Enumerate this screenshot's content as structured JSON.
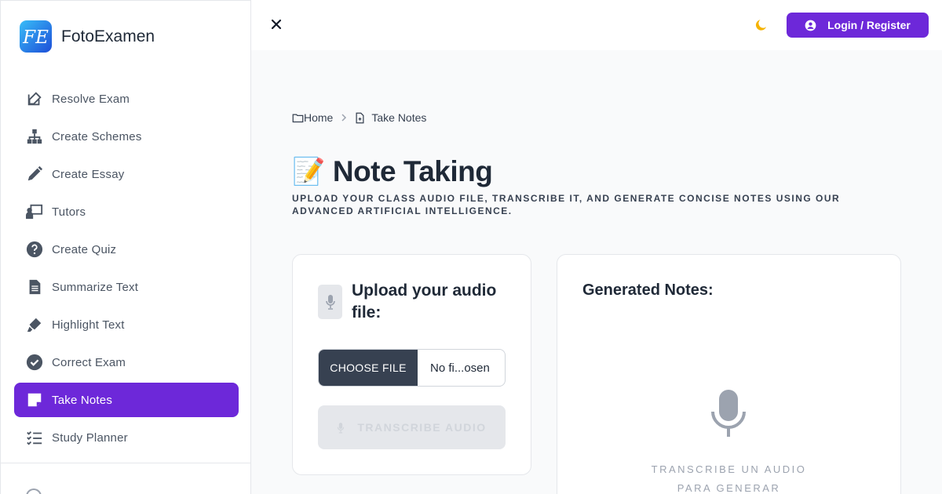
{
  "brand": {
    "name": "FotoExamen",
    "logo_text": "FE"
  },
  "sidebar": {
    "items": [
      {
        "label": "Resolve Exam",
        "icon": "edit-square-icon",
        "active": false
      },
      {
        "label": "Create Schemes",
        "icon": "hierarchy-icon",
        "active": false
      },
      {
        "label": "Create Essay",
        "icon": "pencil-icon",
        "active": false
      },
      {
        "label": "Tutors",
        "icon": "tutor-board-icon",
        "active": false
      },
      {
        "label": "Create Quiz",
        "icon": "question-circle-icon",
        "active": false
      },
      {
        "label": "Summarize Text",
        "icon": "document-icon",
        "active": false
      },
      {
        "label": "Highlight Text",
        "icon": "highlighter-icon",
        "active": false
      },
      {
        "label": "Correct Exam",
        "icon": "check-circle-icon",
        "active": false
      },
      {
        "label": "Take Notes",
        "icon": "sticky-note-icon",
        "active": true
      },
      {
        "label": "Study Planner",
        "icon": "checklist-icon",
        "active": false
      }
    ]
  },
  "topbar": {
    "login_label": "Login / Register"
  },
  "breadcrumb": {
    "home": "Home",
    "current": "Take Notes"
  },
  "page": {
    "title_emoji": "📝",
    "title": "Note Taking",
    "subtitle": "Upload your class audio file, transcribe it, and generate concise notes using our advanced artificial intelligence."
  },
  "upload": {
    "title": "Upload your audio file:",
    "choose_file_label": "CHOOSE FILE",
    "file_status": "No fi...osen",
    "transcribe_label": "TRANSCRIBE AUDIO"
  },
  "notes": {
    "title": "Generated Notes:",
    "empty_line1": "Transcribe un audio",
    "empty_line2": "para generar"
  },
  "colors": {
    "accent": "#6d28d9",
    "moon": "#f5b301",
    "dark_button": "#374151"
  }
}
